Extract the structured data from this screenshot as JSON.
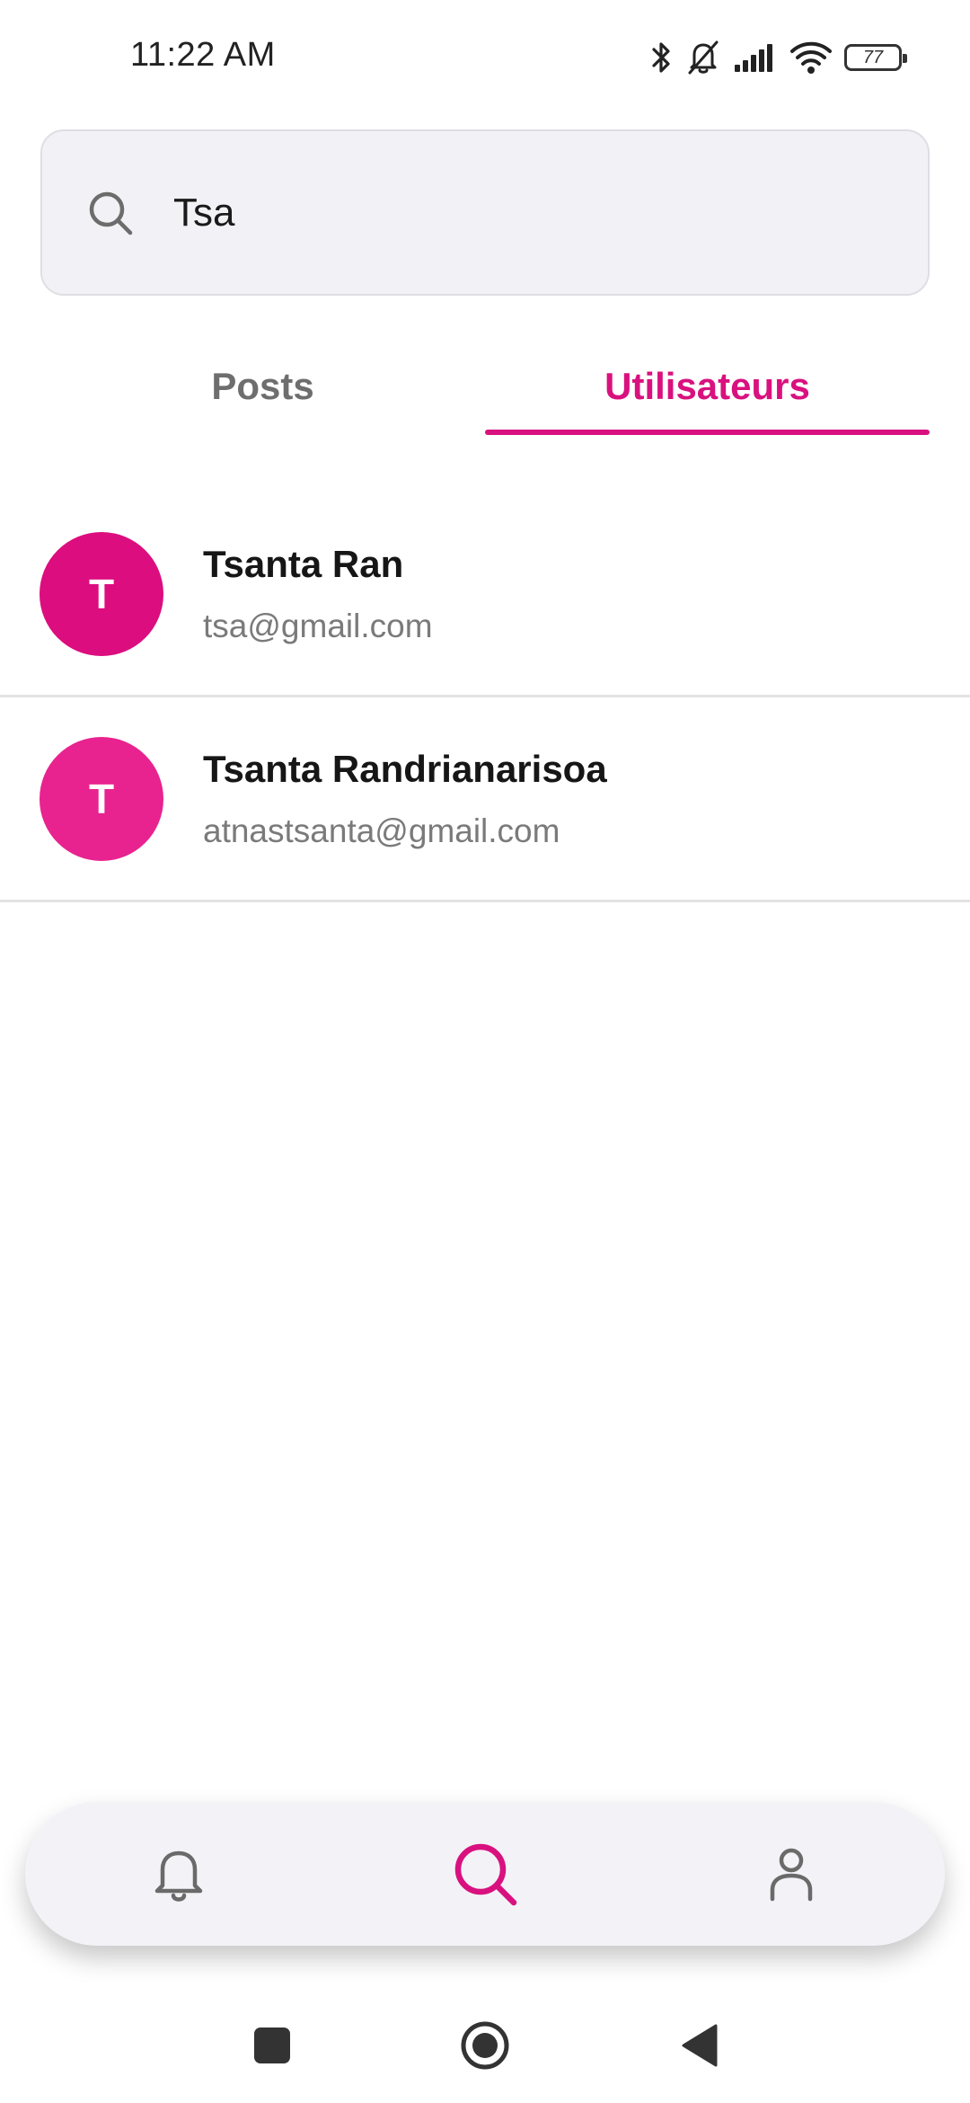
{
  "status_bar": {
    "time": "11:22 AM",
    "battery_level": "77",
    "icons": [
      "bluetooth-icon",
      "notifications-muted-icon",
      "cell-signal-icon",
      "wifi-icon",
      "battery-icon"
    ]
  },
  "search": {
    "value": "Tsa",
    "icon": "search-icon"
  },
  "tabs": [
    {
      "label": "Posts",
      "active": false
    },
    {
      "label": "Utilisateurs",
      "active": true
    }
  ],
  "users": [
    {
      "initial": "T",
      "name": "Tsanta Ran",
      "email": "tsa@gmail.com",
      "avatar_color": "#dc0d7e"
    },
    {
      "initial": "T",
      "name": "Tsanta Randrianarisoa",
      "email": "atnastsanta@gmail.com",
      "avatar_color": "#e8238f"
    }
  ],
  "bottom_nav": {
    "items": [
      {
        "icon": "bell-icon",
        "active": false
      },
      {
        "icon": "search-icon",
        "active": true
      },
      {
        "icon": "profile-icon",
        "active": false
      }
    ]
  },
  "system_nav": {
    "items": [
      "recents-button",
      "home-button",
      "back-button"
    ]
  },
  "colors": {
    "accent": "#d9117f",
    "inactive_text": "#6e6e6e",
    "search_background": "#f2f2f6",
    "nav_background": "#f3f2f7",
    "divider": "#e3e3e3"
  }
}
